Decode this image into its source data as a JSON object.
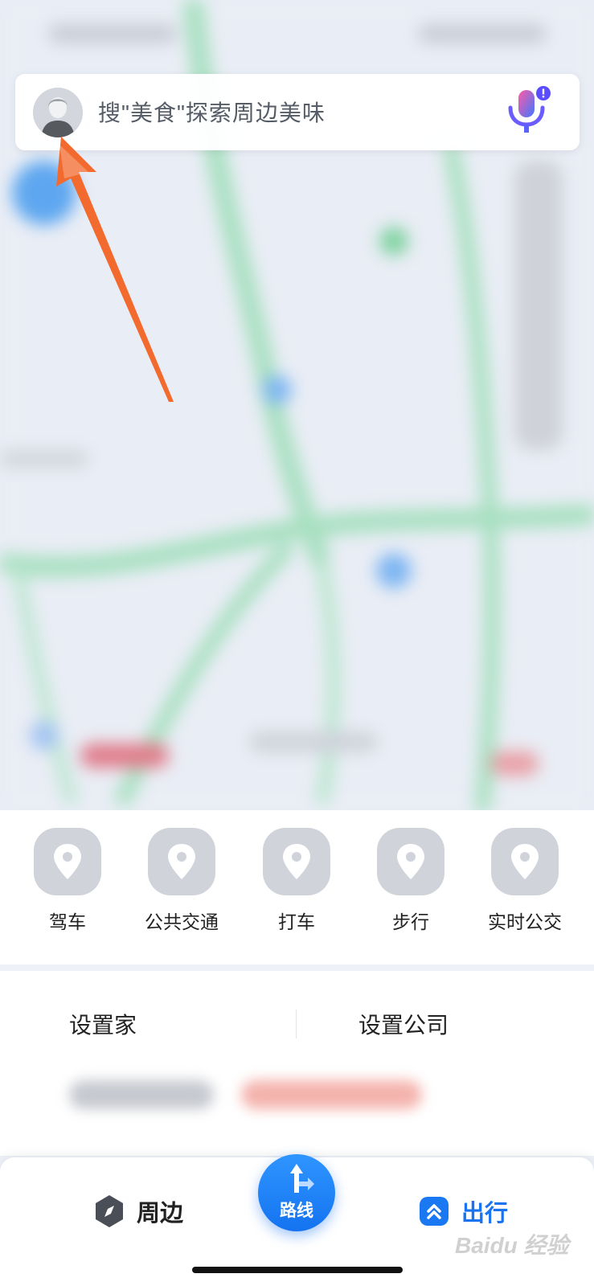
{
  "search": {
    "placeholder": "搜\"美食\"探索周边美味"
  },
  "travel_modes": [
    {
      "label": "驾车"
    },
    {
      "label": "公共交通"
    },
    {
      "label": "打车"
    },
    {
      "label": "步行"
    },
    {
      "label": "实时公交"
    }
  ],
  "shortcuts": {
    "home_label": "设置家",
    "company_label": "设置公司"
  },
  "bottom_nav": {
    "nearby_label": "周边",
    "route_label": "路线",
    "travel_label": "出行"
  },
  "watermark": "Baidu 经验",
  "colors": {
    "accent_blue": "#1473f0",
    "annotation_arrow": "#f26a2e",
    "map_road": "#9fdcb8",
    "icon_gray": "#d0d3d9"
  }
}
